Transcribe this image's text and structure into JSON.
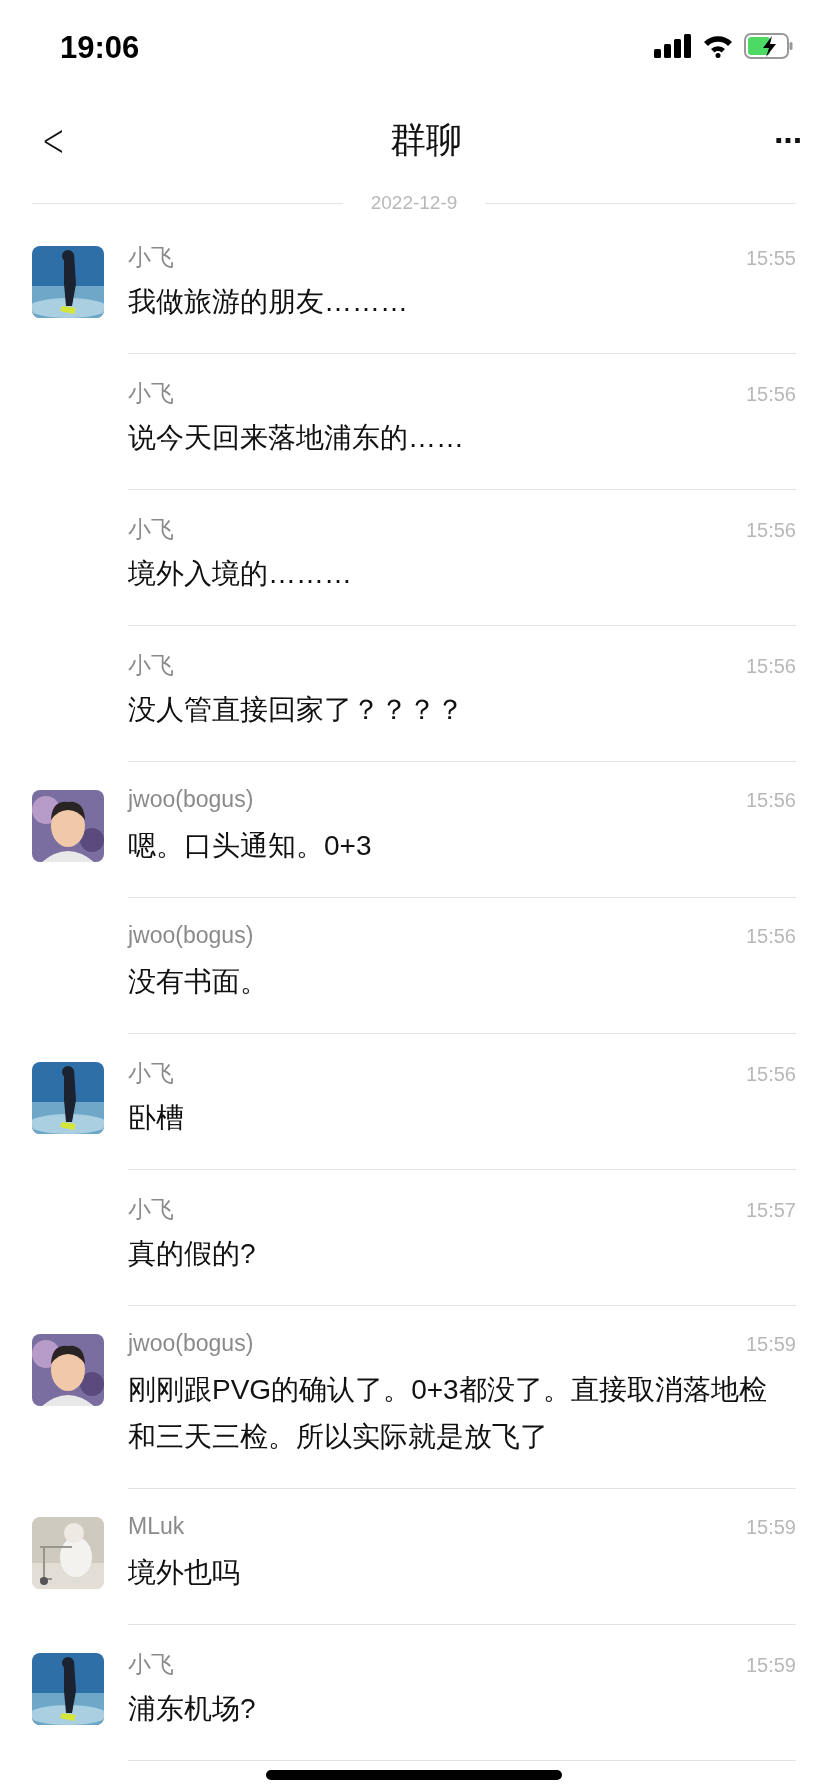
{
  "status_bar": {
    "time": "19:06"
  },
  "nav": {
    "back": "<",
    "title": "群聊",
    "more": "···"
  },
  "date": "2022-12-9",
  "messages": [
    {
      "sender": "小飞",
      "time": "15:55",
      "text": "我做旅游的朋友………"
    },
    {
      "sender": "小飞",
      "time": "15:56",
      "text": "说今天回来落地浦东的……"
    },
    {
      "sender": "小飞",
      "time": "15:56",
      "text": "境外入境的………"
    },
    {
      "sender": "小飞",
      "time": "15:56",
      "text": "没人管直接回家了？？？？"
    },
    {
      "sender": "jwoo(bogus)",
      "time": "15:56",
      "text": "嗯。口头通知。0+3"
    },
    {
      "sender": "jwoo(bogus)",
      "time": "15:56",
      "text": "没有书面。"
    },
    {
      "sender": "小飞",
      "time": "15:56",
      "text": "卧槽"
    },
    {
      "sender": "小飞",
      "time": "15:57",
      "text": "真的假的?"
    },
    {
      "sender": "jwoo(bogus)",
      "time": "15:59",
      "text": "刚刚跟PVG的确认了。0+3都没了。直接取消落地检和三天三检。所以实际就是放飞了"
    },
    {
      "sender": "MLuk",
      "time": "15:59",
      "text": "境外也吗"
    },
    {
      "sender": "小飞",
      "time": "15:59",
      "text": "浦东机场?"
    }
  ]
}
